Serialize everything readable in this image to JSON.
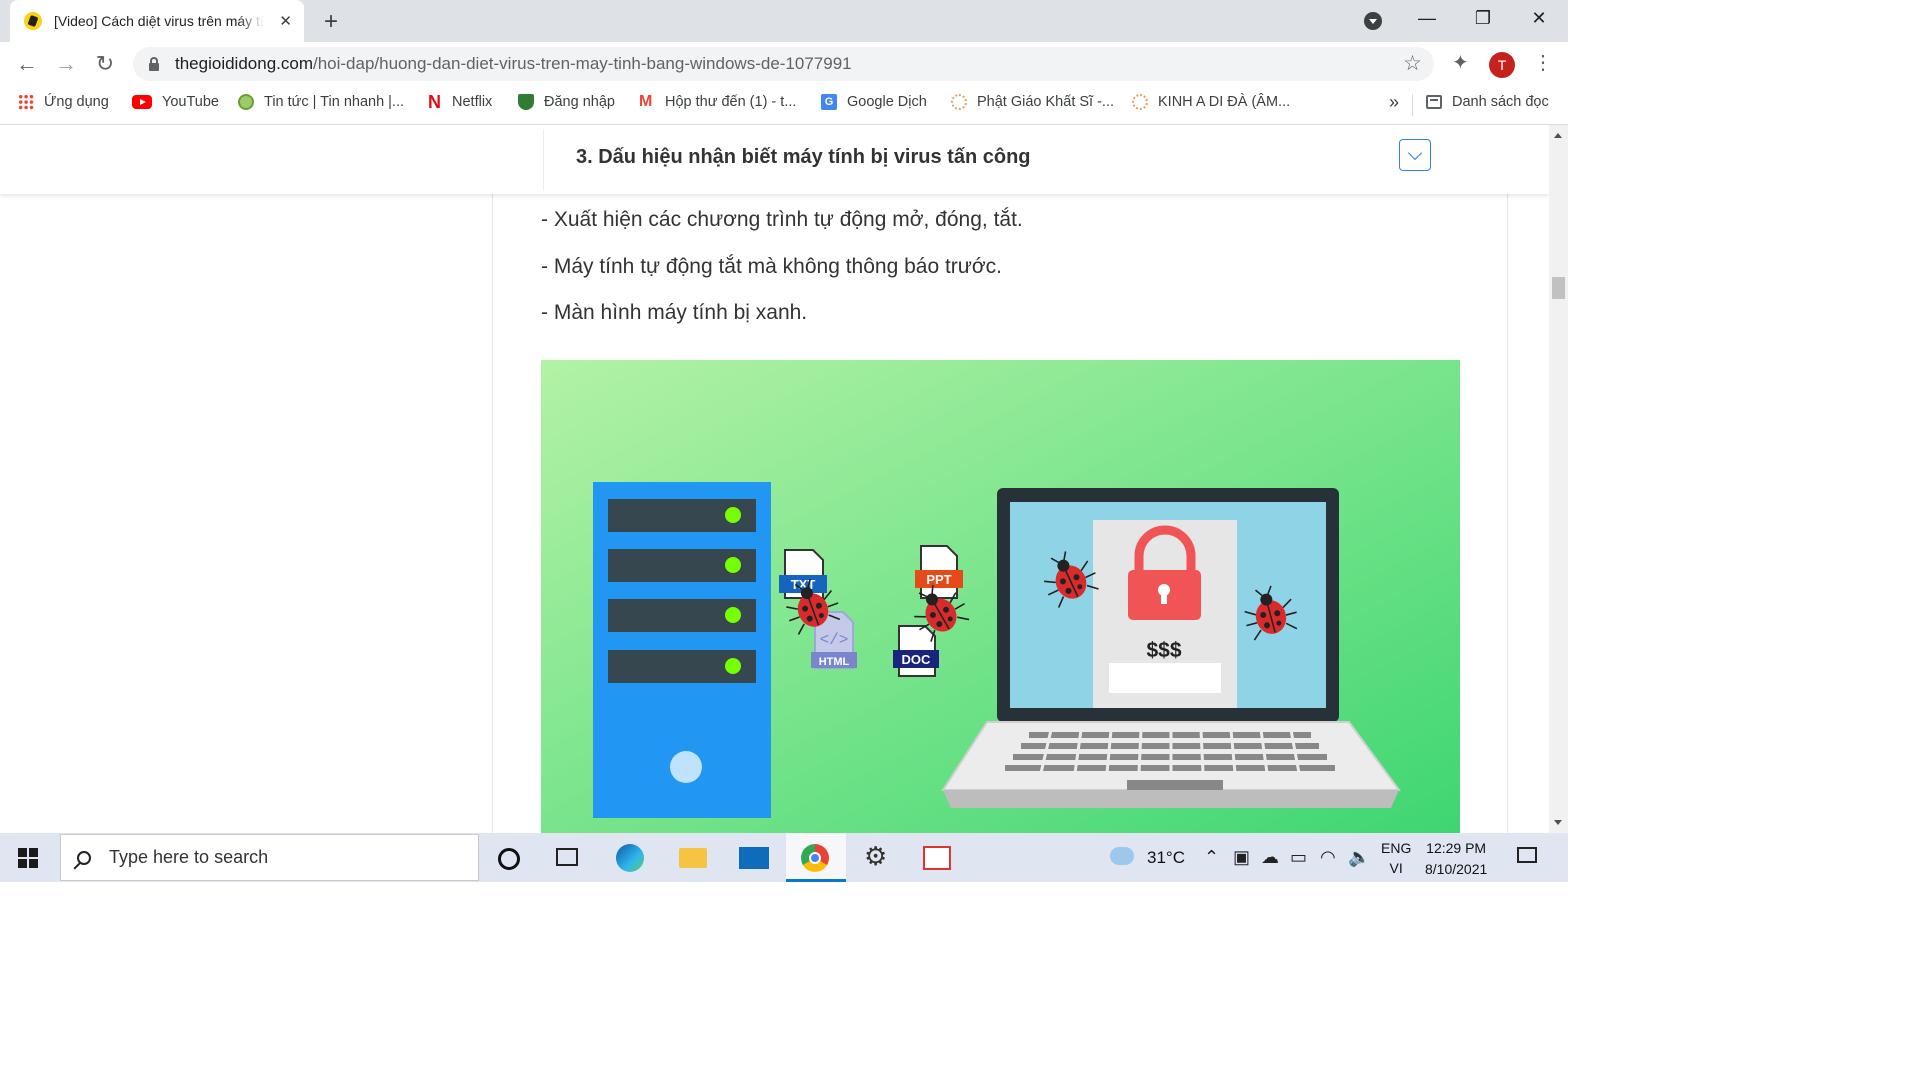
{
  "browser": {
    "tab": {
      "title": "[Video] Cách diệt virus trên máy tính",
      "close": "✕"
    },
    "new_tab": "+",
    "window_controls": {
      "minimize": "—",
      "maximize": "❐",
      "close": "✕"
    },
    "url_host": "thegioididong.com",
    "url_path": "/hoi-dap/huong-dan-diet-virus-tren-may-tinh-bang-windows-de-1077991",
    "profile_initial": "T",
    "bookmarks": [
      {
        "label": "Ứng dụng",
        "icon": "apps-grid-icon"
      },
      {
        "label": "YouTube",
        "icon": "youtube-icon"
      },
      {
        "label": "Tin tức | Tin nhanh |...",
        "icon": "news-icon"
      },
      {
        "label": "Netflix",
        "icon": "netflix-icon"
      },
      {
        "label": "Đăng nhập",
        "icon": "shield-icon"
      },
      {
        "label": "Hộp thư đến (1) - t...",
        "icon": "gmail-icon"
      },
      {
        "label": "Google Dịch",
        "icon": "google-translate-icon"
      },
      {
        "label": "Phật Giáo Khất Sĩ -...",
        "icon": "sun-icon"
      },
      {
        "label": "KINH A DI ĐÀ (ÂM...",
        "icon": "sun-icon"
      }
    ],
    "bookmarks_more": "»",
    "reading_list": "Danh sách đọc"
  },
  "page": {
    "toc_title": "3. Dấu hiệu nhận biết máy tính bị virus tấn công",
    "lines": [
      "- Xuất hiện các chương trình tự động mở, đóng, tắt.",
      "- Máy tính tự động tắt mà không thông báo trước.",
      "- Màn hình máy tính bị xanh."
    ],
    "illustration": {
      "files": [
        "TXT",
        "HTML",
        "PPT",
        "DOC"
      ],
      "ransom_text": "$$$",
      "colors": {
        "bg_top": "#b3f2a6",
        "bg_bottom": "#3ed672",
        "server": "#2196f3",
        "lock": "#f05454"
      }
    }
  },
  "taskbar": {
    "search_placeholder": "Type here to search",
    "temperature": "31°C",
    "lang_top": "ENG",
    "lang_bottom": "VI",
    "time": "12:29 PM",
    "date": "8/10/2021"
  }
}
